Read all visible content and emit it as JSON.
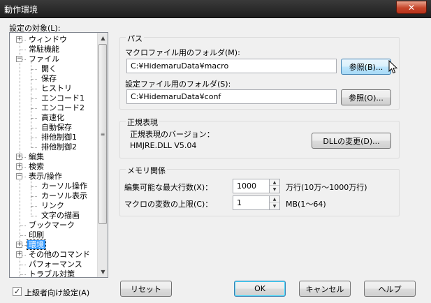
{
  "window": {
    "title": "動作環境",
    "close_glyph": "✕"
  },
  "tree": {
    "label": "設定の対象(L):",
    "items": [
      {
        "label": "ウィンドウ",
        "level": 0,
        "expander": "+"
      },
      {
        "label": "常駐機能",
        "level": 0,
        "expander": ""
      },
      {
        "label": "ファイル",
        "level": 0,
        "expander": "−"
      },
      {
        "label": "開く",
        "level": 1,
        "expander": ""
      },
      {
        "label": "保存",
        "level": 1,
        "expander": ""
      },
      {
        "label": "ヒストリ",
        "level": 1,
        "expander": ""
      },
      {
        "label": "エンコード1",
        "level": 1,
        "expander": ""
      },
      {
        "label": "エンコード2",
        "level": 1,
        "expander": ""
      },
      {
        "label": "高速化",
        "level": 1,
        "expander": ""
      },
      {
        "label": "自動保存",
        "level": 1,
        "expander": ""
      },
      {
        "label": "排他制御1",
        "level": 1,
        "expander": ""
      },
      {
        "label": "排他制御2",
        "level": 1,
        "expander": ""
      },
      {
        "label": "編集",
        "level": 0,
        "expander": "+"
      },
      {
        "label": "検索",
        "level": 0,
        "expander": "+"
      },
      {
        "label": "表示/操作",
        "level": 0,
        "expander": "−"
      },
      {
        "label": "カーソル操作",
        "level": 1,
        "expander": ""
      },
      {
        "label": "カーソル表示",
        "level": 1,
        "expander": ""
      },
      {
        "label": "リンク",
        "level": 1,
        "expander": ""
      },
      {
        "label": "文字の描画",
        "level": 1,
        "expander": ""
      },
      {
        "label": "ブックマーク",
        "level": 0,
        "expander": ""
      },
      {
        "label": "印刷",
        "level": 0,
        "expander": ""
      },
      {
        "label": "環境",
        "level": 0,
        "expander": "+",
        "selected": true
      },
      {
        "label": "その他のコマンド",
        "level": 0,
        "expander": "+"
      },
      {
        "label": "パフォーマンス",
        "level": 0,
        "expander": ""
      },
      {
        "label": "トラブル対策",
        "level": 0,
        "expander": ""
      }
    ],
    "scroll": {
      "up": "▲",
      "down": "▼",
      "grip": "≡"
    }
  },
  "path_group": {
    "title": "パス",
    "macro_label": "マクロファイル用のフォルダ(M):",
    "macro_value": "C:¥HidemaruData¥macro",
    "macro_browse": "参照(B)...",
    "config_label": "設定ファイル用のフォルダ(S):",
    "config_value": "C:¥HidemaruData¥conf",
    "config_browse": "参照(O)..."
  },
  "regex_group": {
    "title": "正規表現",
    "version_label": "正規表現のバージョン：",
    "version_value": "HMJRE.DLL  V5.04",
    "change_dll": "DLLの変更(D)..."
  },
  "memory_group": {
    "title": "メモリ関係",
    "max_lines_label": "編集可能な最大行数(X)：",
    "max_lines_value": "1000",
    "max_lines_unit": "万行(10万～1000万行)",
    "macro_vars_label": "マクロの変数の上限(C)：",
    "macro_vars_value": "1",
    "macro_vars_unit": "MB(1～64)",
    "spin_up": "▲",
    "spin_down": "▼"
  },
  "footer": {
    "advanced_label": "上級者向け設定(A)",
    "advanced_checked": true,
    "check_glyph": "✓",
    "reset": "リセット",
    "ok": "OK",
    "cancel": "キャンセル",
    "help": "ヘルプ"
  }
}
